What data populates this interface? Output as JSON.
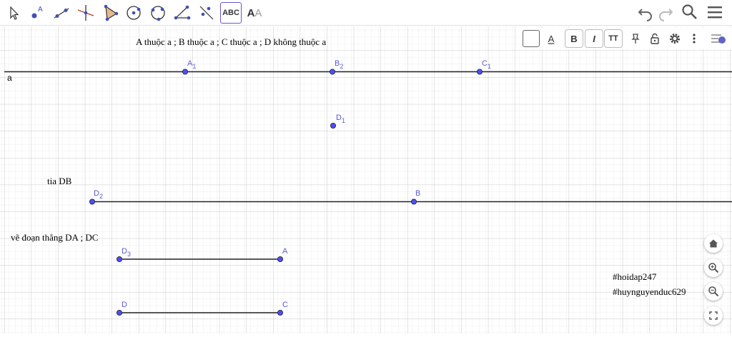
{
  "toolbar": {
    "tools": [
      {
        "name": "move-tool-icon"
      },
      {
        "name": "point-tool-icon",
        "label": "A"
      },
      {
        "name": "line-tool-icon"
      },
      {
        "name": "perpendicular-line-tool-icon"
      },
      {
        "name": "polygon-tool-icon"
      },
      {
        "name": "circle-center-point-tool-icon"
      },
      {
        "name": "circle-three-points-tool-icon"
      },
      {
        "name": "angle-tool-icon"
      },
      {
        "name": "reflect-tool-icon"
      },
      {
        "name": "text-tool",
        "label": "ABC"
      },
      {
        "name": "slider-text-tool",
        "label_dark": "A",
        "label_light": "A"
      }
    ],
    "right": [
      "undo-icon",
      "redo-icon",
      "search-icon",
      "menu-icon"
    ]
  },
  "stylebar": {
    "text_color_label": "A",
    "bold_label": "B",
    "italic_label": "I",
    "size_label": "TT",
    "icons": [
      "pin-icon",
      "lock-icon",
      "settings-icon",
      "more-icon",
      "toggle-style-bar-icon"
    ]
  },
  "graphics": {
    "texts": {
      "line_a_caption": "A thuộc a ; B thuộc a ; C thuộc a ; D không thuộc a",
      "line_a_label": "a",
      "ray_caption": "tia DB",
      "segment_caption": "vẽ đoạn thẳng DA ; DC",
      "hashtag1": "#hoidap247",
      "hashtag2": "#huynguyenduc629"
    },
    "points": {
      "A1": {
        "name": "A",
        "sub": "1"
      },
      "B2": {
        "name": "B",
        "sub": "2"
      },
      "C1": {
        "name": "C",
        "sub": "1"
      },
      "D1": {
        "name": "D",
        "sub": "1"
      },
      "D2": {
        "name": "D",
        "sub": "2"
      },
      "B": {
        "name": "B",
        "sub": ""
      },
      "D3": {
        "name": "D",
        "sub": "3"
      },
      "A": {
        "name": "A",
        "sub": ""
      },
      "D": {
        "name": "D",
        "sub": ""
      },
      "C": {
        "name": "C",
        "sub": ""
      }
    }
  },
  "zoom_controls": [
    "home-icon",
    "zoom-in-icon",
    "zoom-out-icon",
    "fullscreen-icon"
  ],
  "colors": {
    "accent": "#6557d2",
    "point_fill": "#4d4dff",
    "label": "#5c5cd6",
    "grid_major": "#c8c8c8",
    "grid_minor": "#ececec"
  }
}
